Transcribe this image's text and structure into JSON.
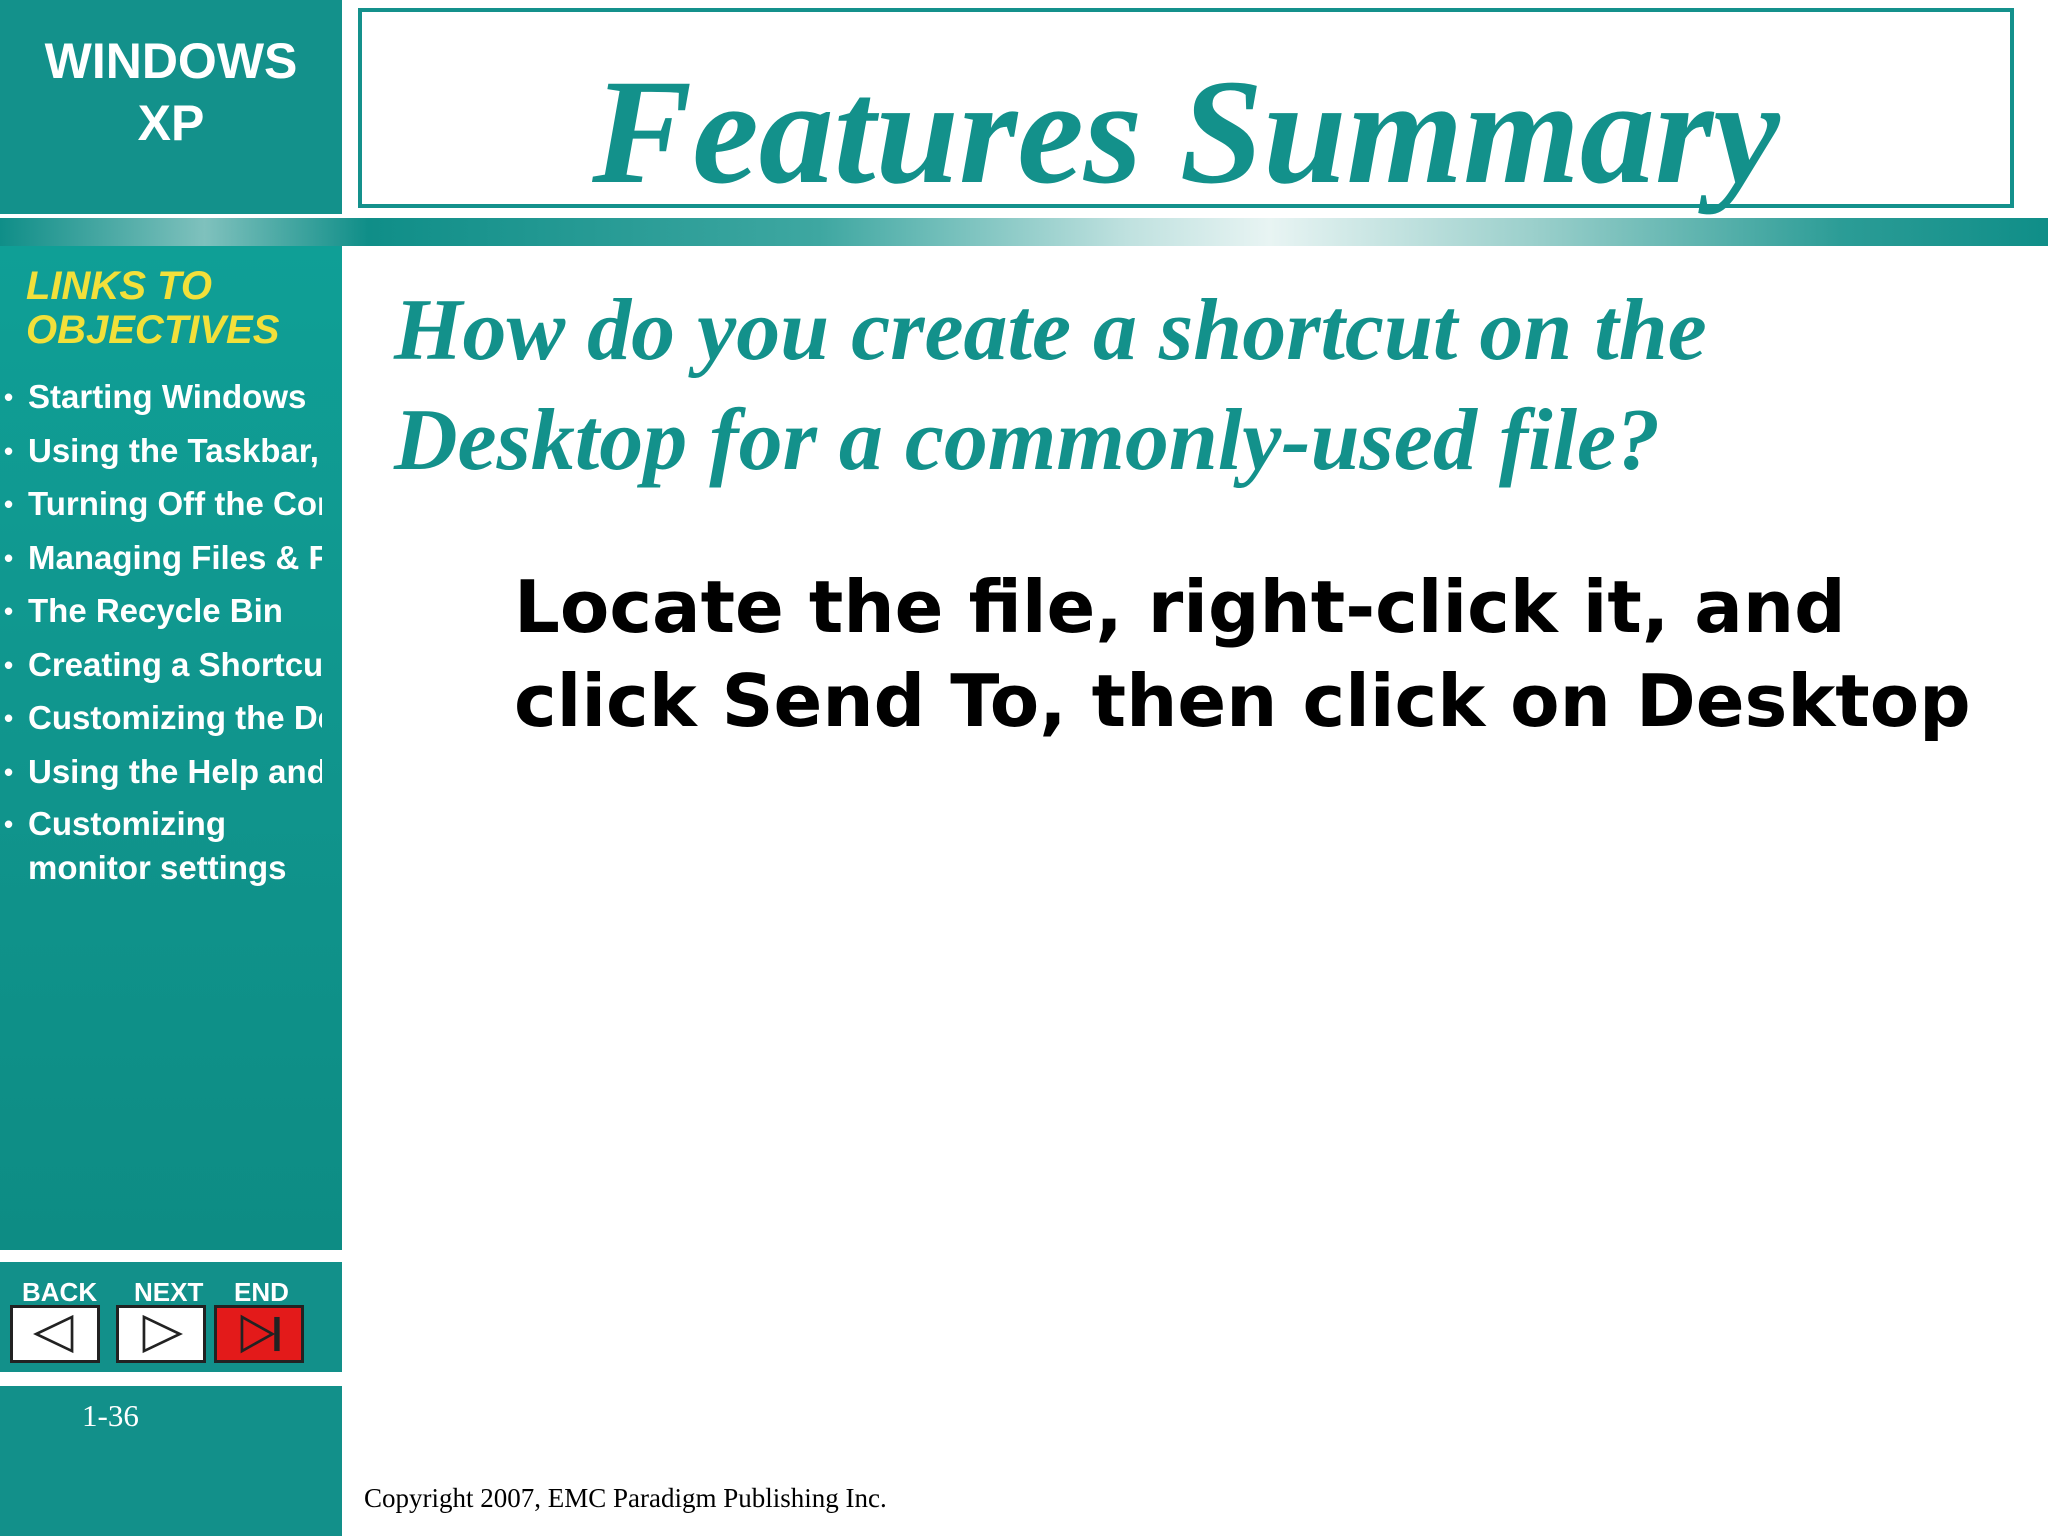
{
  "sidebar": {
    "brand_line1": "WINDOWS",
    "brand_line2": "XP",
    "links_heading_line1": "LINKS TO",
    "links_heading_line2": "OBJECTIVES",
    "links": [
      "Starting Windows",
      "Using the Taskbar, o",
      "Turning Off the Comp",
      "Managing Files & Fol",
      "The Recycle Bin",
      "Creating a Shortcut",
      "Customizing the Des",
      "Using the Help and S",
      "Customizing monitor settings"
    ]
  },
  "nav": {
    "back_label": "BACK",
    "next_label": "NEXT",
    "end_label": "END",
    "icons": [
      "arrow-left-icon",
      "arrow-right-icon",
      "skip-to-end-icon"
    ],
    "end_color": "#e31a1a"
  },
  "page_number": "1-36",
  "title": "Features Summary",
  "question": "How do you create a shortcut on the Desktop for a commonly-used file?",
  "answer": "Locate the file, right-click it, and click Send To, then click on Desktop",
  "copyright": "Copyright 2007, EMC Paradigm Publishing Inc.",
  "colors": {
    "accent": "#13918b",
    "heading_yellow": "#f2e03a"
  }
}
